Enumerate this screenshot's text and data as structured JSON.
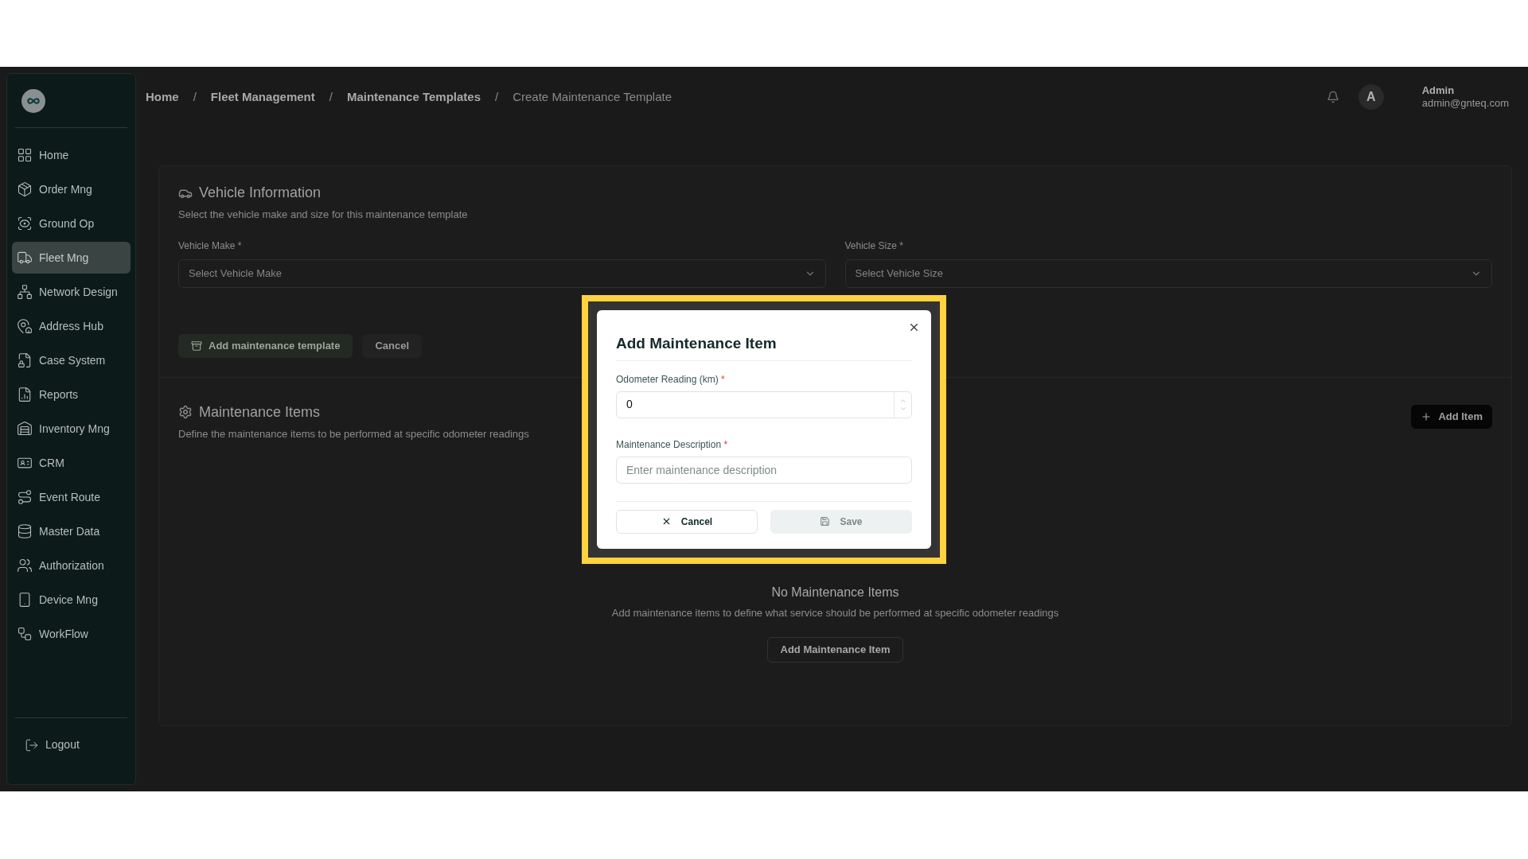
{
  "sidebar": {
    "items": [
      {
        "label": "Home",
        "selected": false
      },
      {
        "label": "Order Mng",
        "selected": false
      },
      {
        "label": "Ground Op",
        "selected": false
      },
      {
        "label": "Fleet Mng",
        "selected": true
      },
      {
        "label": "Network Design",
        "selected": false
      },
      {
        "label": "Address Hub",
        "selected": false
      },
      {
        "label": "Case System",
        "selected": false
      },
      {
        "label": "Reports",
        "selected": false
      },
      {
        "label": "Inventory Mng",
        "selected": false
      },
      {
        "label": "CRM",
        "selected": false
      },
      {
        "label": "Event Route",
        "selected": false
      },
      {
        "label": "Master Data",
        "selected": false
      },
      {
        "label": "Authorization",
        "selected": false
      },
      {
        "label": "Device Mng",
        "selected": false
      },
      {
        "label": "WorkFlow",
        "selected": false
      }
    ],
    "logout": "Logout"
  },
  "breadcrumb": {
    "separator": "/",
    "items": [
      {
        "label": "Home",
        "current": false
      },
      {
        "label": "Fleet Management",
        "current": false
      },
      {
        "label": "Maintenance Templates",
        "current": false
      },
      {
        "label": "Create Maintenance Template",
        "current": true
      }
    ]
  },
  "header": {
    "avatar": "A",
    "user_name": "Admin",
    "user_email": "admin@gnteq.com"
  },
  "vehicle_info": {
    "title": "Vehicle Information",
    "subtitle": "Select the vehicle make and size for this maintenance template",
    "fields": [
      {
        "label": "Vehicle Make",
        "required_mark": "*",
        "placeholder": "Select Vehicle Make"
      },
      {
        "label": "Vehicle Size",
        "required_mark": "*",
        "placeholder": "Select Vehicle Size"
      }
    ],
    "buttons": [
      {
        "label": "Add maintenance template",
        "kind": "primary"
      },
      {
        "label": "Cancel",
        "kind": "plain"
      }
    ]
  },
  "maintenance_items": {
    "title": "Maintenance Items",
    "subtitle": "Define the maintenance items to be performed at specific odometer readings",
    "add_button": "Add Item",
    "empty_title": "No Maintenance Items",
    "empty_text": "Add maintenance items to define what service should be performed at specific odometer readings",
    "empty_button": "Add Maintenance Item"
  },
  "dialog": {
    "title": "Add Maintenance Item",
    "fields": [
      {
        "label": "Odometer Reading (km)",
        "required_mark": "*",
        "kind": "number",
        "value": "0"
      },
      {
        "label": "Maintenance Description",
        "required_mark": "*",
        "kind": "text",
        "placeholder": "Enter maintenance description"
      }
    ],
    "cancel": "Cancel",
    "save": {
      "label": "Save",
      "disabled": true
    }
  }
}
